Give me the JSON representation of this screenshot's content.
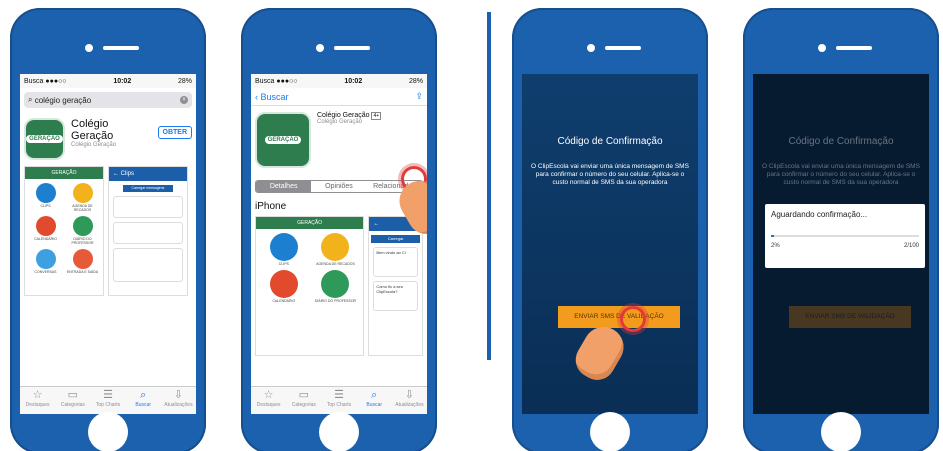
{
  "phone1": {
    "status": {
      "left": "Busca ●●●○○",
      "time": "10:02",
      "right": "28%"
    },
    "search_text": "colégio geração",
    "app": {
      "name": "Colégio Geração",
      "sub": "Colégio Geração",
      "get_button": "OBTER"
    },
    "shot1": {
      "header": "GERAÇÃO",
      "items": [
        "CLIPS",
        "AGENDA DE RECADOS",
        "CALENDÁRIO",
        "DIÁRIO DO PROFESSOR",
        "CONVERSAS",
        "ENTRADA E SAÍDA"
      ]
    },
    "shot2": {
      "header": "Clips",
      "button": "Carregar mensagens"
    },
    "tabs": [
      "Destaques",
      "Categorias",
      "Top Charts",
      "Buscar",
      "Atualizações"
    ]
  },
  "phone2": {
    "status": {
      "left": "Busca ●●●○○",
      "time": "10:02",
      "right": "28%"
    },
    "back": "Buscar",
    "app": {
      "name": "Colégio Geração",
      "sub": "Colégio Geração",
      "badge": "4+"
    },
    "segments": [
      "Detalhes",
      "Opiniões",
      "Relacionados"
    ],
    "iphone": "iPhone",
    "shot1": {
      "header": "GERAÇÃO",
      "items": [
        "CLIPS",
        "AGENDA DE RECADOS",
        "CALENDÁRIO",
        "DIÁRIO DO PROFESSOR"
      ]
    },
    "shot2": {
      "button": "Carregar",
      "msg1": "Bem vindo ao Cl",
      "msg2": "Como fic a seu ClipEscola?"
    },
    "tabs": [
      "Destaques",
      "Categorias",
      "Top Charts",
      "Buscar",
      "Atualizações"
    ]
  },
  "phone3": {
    "title": "Código de Confirmação",
    "text": "O ClipEscola vai enviar uma única mensagem de SMS para confirmar o número do seu celular. Aplica-se o custo normal de SMS da sua operadora",
    "button": "ENVIAR SMS DE VALIDAÇÃO"
  },
  "phone4": {
    "title": "Código de Confirmação",
    "text": "O ClipEscola vai enviar uma única mensagem de SMS para confirmar o número do seu celular. Aplica-se o custo normal de SMS da sua operadora",
    "dialog": {
      "title": "Aguardando confirmação...",
      "percent": "2%",
      "count": "2/100",
      "progress": 0.02
    },
    "button": "ENVIAR SMS DE VALIDAÇÃO"
  }
}
